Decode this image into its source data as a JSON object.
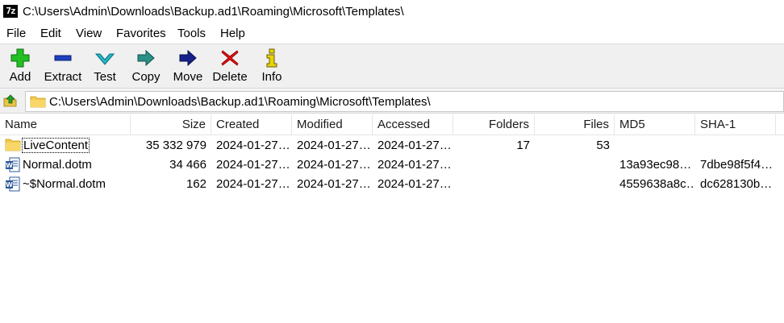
{
  "window": {
    "app_icon": "7z",
    "title": "C:\\Users\\Admin\\Downloads\\Backup.ad1\\Roaming\\Microsoft\\Templates\\"
  },
  "menu": [
    "File",
    "Edit",
    "View",
    "Favorites",
    "Tools",
    "Help"
  ],
  "toolbar": {
    "buttons": [
      {
        "label": "Add",
        "icon": "plus-icon",
        "color": "#22c022"
      },
      {
        "label": "Extract",
        "icon": "minus-icon",
        "color": "#1f3fbf"
      },
      {
        "label": "Test",
        "icon": "checkmark-icon",
        "color": "#22b5c8"
      },
      {
        "label": "Copy",
        "icon": "copy-arrow-icon",
        "color": "#2a8f86"
      },
      {
        "label": "Move",
        "icon": "move-arrow-icon",
        "color": "#16208a"
      },
      {
        "label": "Delete",
        "icon": "x-icon",
        "color": "#e01010"
      },
      {
        "label": "Info",
        "icon": "info-icon",
        "color": "#e8d20a"
      }
    ]
  },
  "address": {
    "path": "C:\\Users\\Admin\\Downloads\\Backup.ad1\\Roaming\\Microsoft\\Templates\\"
  },
  "columns": [
    "Name",
    "Size",
    "Created",
    "Modified",
    "Accessed",
    "Folders",
    "Files",
    "MD5",
    "SHA-1"
  ],
  "rows": [
    {
      "name": "LiveContent",
      "type": "folder",
      "size": "35 332 979",
      "created": "2024-01-27…",
      "modified": "2024-01-27…",
      "accessed": "2024-01-27…",
      "folders": "17",
      "files": "53",
      "md5": "",
      "sha1": ""
    },
    {
      "name": "Normal.dotm",
      "type": "word-doc",
      "size": "34 466",
      "created": "2024-01-27…",
      "modified": "2024-01-27…",
      "accessed": "2024-01-27…",
      "folders": "",
      "files": "",
      "md5": "13a93ec98…",
      "sha1": "7dbe98f5f4…"
    },
    {
      "name": "~$Normal.dotm",
      "type": "word-doc",
      "size": "162",
      "created": "2024-01-27…",
      "modified": "2024-01-27…",
      "accessed": "2024-01-27…",
      "folders": "",
      "files": "",
      "md5": "4559638a8c…",
      "sha1": "dc628130b…"
    }
  ]
}
